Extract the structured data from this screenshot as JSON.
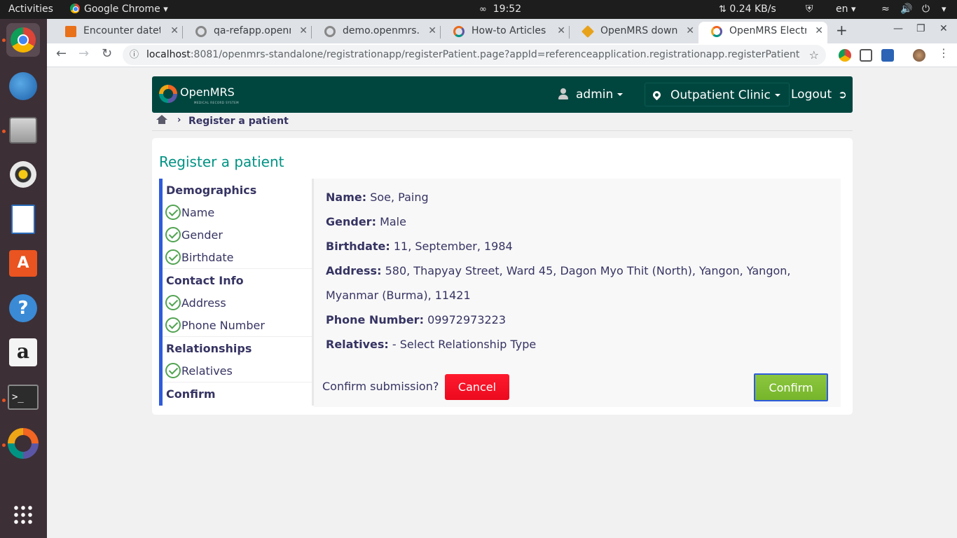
{
  "os": {
    "activities": "Activities",
    "app_name": "Google Chrome",
    "clock": "19:52",
    "network_speed": "0.24 KB/s",
    "language": "en"
  },
  "browser": {
    "tabs": [
      {
        "label": "Encounter dateti",
        "favicon": "grid-icon",
        "color": "#e8711a"
      },
      {
        "label": "qa-refapp.openm",
        "favicon": "openmrs-icon",
        "color": "#777777"
      },
      {
        "label": "demo.openmrs.o",
        "favicon": "openmrs-icon",
        "color": "#777777"
      },
      {
        "label": "How-to Articles - ",
        "favicon": "openmrs-icon",
        "color": "#e96b1b"
      },
      {
        "label": "OpenMRS downlo",
        "favicon": "diamond-icon",
        "color": "#e8a21a"
      },
      {
        "label": "OpenMRS Electro",
        "favicon": "openmrs-icon",
        "color": "#009384",
        "active": true
      }
    ],
    "url_host": "localhost",
    "url_path": ":8081/openmrs-standalone/registrationapp/registerPatient.page?appId=referenceapplication.registrationapp.registerPatient"
  },
  "header": {
    "brand": "OpenMRS",
    "tagline": "MEDICAL RECORD SYSTEM",
    "user": "admin",
    "location": "Outpatient Clinic",
    "logout": "Logout"
  },
  "breadcrumb": {
    "current": "Register a patient"
  },
  "page": {
    "title": "Register a patient"
  },
  "sidenav": {
    "demographics": {
      "title": "Demographics",
      "items": [
        "Name",
        "Gender",
        "Birthdate"
      ]
    },
    "contact": {
      "title": "Contact Info",
      "items": [
        "Address",
        "Phone Number"
      ]
    },
    "relationships": {
      "title": "Relationships",
      "items": [
        "Relatives"
      ]
    },
    "confirm": {
      "title": "Confirm"
    }
  },
  "summary": {
    "name": {
      "label": "Name:",
      "value": "Soe, Paing"
    },
    "gender": {
      "label": "Gender:",
      "value": "Male"
    },
    "birthdate": {
      "label": "Birthdate:",
      "value": "11, September, 1984"
    },
    "address": {
      "label": "Address:",
      "value": "580, Thapyay Street, Ward 45, Dagon Myo Thit (North), Yangon, Yangon, Myanmar (Burma), 11421"
    },
    "phone": {
      "label": "Phone Number:",
      "value": "09972973223"
    },
    "relatives": {
      "label": "Relatives:",
      "value": "- Select Relationship Type"
    }
  },
  "actions": {
    "question": "Confirm submission?",
    "cancel": "Cancel",
    "confirm": "Confirm"
  },
  "colors": {
    "header_bg": "#00463f",
    "title_teal": "#009384",
    "nav_accent": "#2f5bdb",
    "cancel_red": "#ec0a1e",
    "confirm_green": "#7ab82e"
  }
}
